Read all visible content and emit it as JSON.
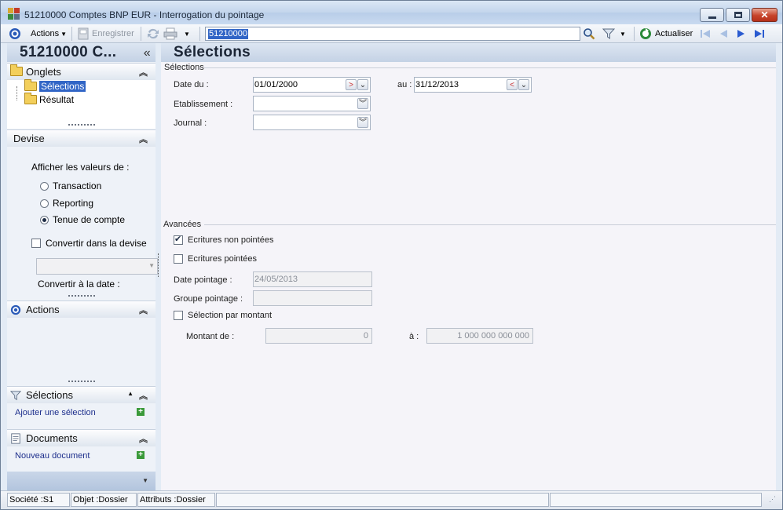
{
  "window": {
    "title": "51210000 Comptes  BNP  EUR -  Interrogation du pointage",
    "minimize": "–",
    "maximize": "",
    "close": "✕"
  },
  "toolbar": {
    "actions_label": "Actions",
    "save_label": "Enregistrer",
    "search_value": "51210000",
    "refresh_label": "Actualiser"
  },
  "left_panel": {
    "header": "51210000 C...",
    "collapse": "«",
    "onglets": {
      "title": "Onglets",
      "items": [
        "Sélections",
        "Résultat"
      ]
    },
    "devise": {
      "title": "Devise",
      "prompt": "Afficher les valeurs de :",
      "options": [
        "Transaction",
        "Reporting",
        "Tenue de compte"
      ],
      "selected": "Tenue de compte",
      "convert_label": "Convertir dans la devise",
      "convert_date_label": "Convertir à la date :"
    },
    "actions": {
      "title": "Actions"
    },
    "selections": {
      "title": "Sélections",
      "add_link": "Ajouter une sélection"
    },
    "documents": {
      "title": "Documents",
      "new_link": "Nouveau document"
    }
  },
  "main": {
    "header": "Sélections",
    "group_selections": "Sélections",
    "date_du_label": "Date du :",
    "date_du_value": "01/01/2000",
    "au_label": "au :",
    "au_value": "31/12/2013",
    "etablissement_label": "Etablissement :",
    "etablissement_value": "",
    "journal_label": "Journal :",
    "journal_value": "",
    "group_avancees": "Avancées",
    "non_pointees_label": "Ecritures non pointées",
    "non_pointees_checked": true,
    "pointees_label": "Ecritures pointées",
    "pointees_checked": false,
    "date_pointage_label": "Date pointage :",
    "date_pointage_value": "24/05/2013",
    "groupe_pointage_label": "Groupe pointage :",
    "groupe_pointage_value": "",
    "par_montant_label": "Sélection par montant",
    "par_montant_checked": false,
    "montant_de_label": "Montant de :",
    "montant_de_value": "0",
    "montant_a_label": "à :",
    "montant_a_value": "1 000 000 000 000"
  },
  "statusbar": {
    "societe": "Société :S1",
    "objet": "Objet :Dossier",
    "attributs": "Attributs :Dossier"
  }
}
